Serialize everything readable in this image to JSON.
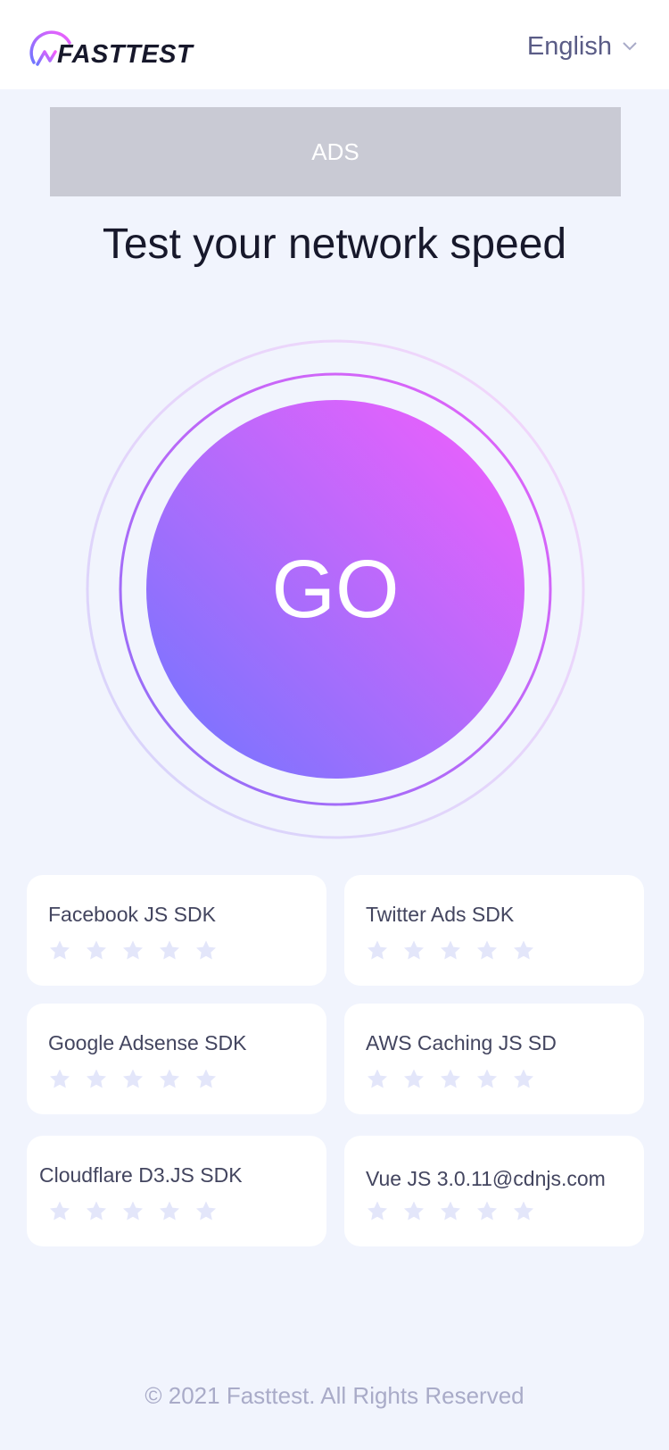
{
  "header": {
    "logo_text": "FASTTEST",
    "language": "English"
  },
  "ads": {
    "label": "ADS"
  },
  "main": {
    "title": "Test your network speed",
    "go_label": "GO"
  },
  "sdk_cards": [
    {
      "name": "Facebook JS SDK",
      "rating": 0
    },
    {
      "name": "Twitter Ads SDK",
      "rating": 0
    },
    {
      "name": "Google Adsense SDK",
      "rating": 0
    },
    {
      "name": "AWS Caching JS SD",
      "rating": 0
    },
    {
      "name": "Cloudflare D3.JS SDK",
      "rating": 0
    },
    {
      "name": "Vue JS 3.0.11@cdnjs.com",
      "rating": 0
    }
  ],
  "footer": {
    "copyright": "© 2021 Fasttest. All Rights Reserved"
  },
  "colors": {
    "background": "#f1f4fd",
    "accent_pink": "#f55efc",
    "accent_blue": "#6f76ff",
    "star_empty": "#e3e6fa"
  }
}
